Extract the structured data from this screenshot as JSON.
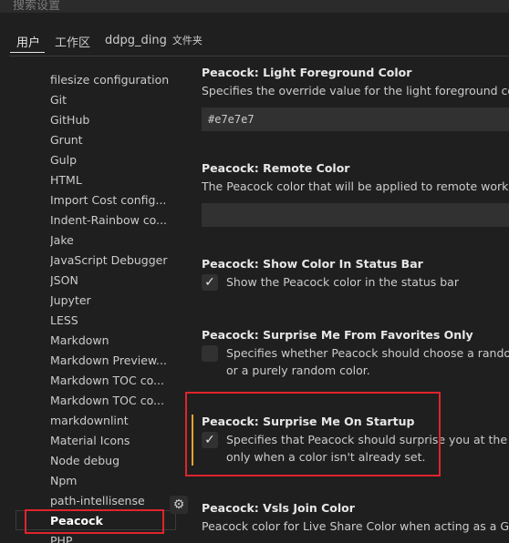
{
  "search": {
    "placeholder": "搜索设置"
  },
  "tabs": {
    "user": "用户",
    "workspace": "工作区",
    "folder": "ddpg_ding",
    "folder_suffix": "文件夹"
  },
  "toc": {
    "items": [
      "filesize configuration",
      "Git",
      "GitHub",
      "Grunt",
      "Gulp",
      "HTML",
      "Import Cost config...",
      "Indent-Rainbow co...",
      "Jake",
      "JavaScript Debugger",
      "JSON",
      "Jupyter",
      "LESS",
      "Markdown",
      "Markdown Preview...",
      "Markdown TOC co...",
      "Markdown TOC co...",
      "markdownlint",
      "Material Icons",
      "Node debug",
      "Npm",
      "path-intellisense",
      "Peacock",
      "PHP"
    ],
    "selected_index": 22
  },
  "settings": {
    "light_fg": {
      "title": "Peacock: Light Foreground Color",
      "desc": "Specifies the override value for the light foreground color",
      "value": "#e7e7e7"
    },
    "remote": {
      "title": "Peacock: Remote Color",
      "desc": "The Peacock color that will be applied to remote workspace",
      "value": ""
    },
    "status_bar": {
      "title": "Peacock: Show Color In Status Bar",
      "desc": "Show the Peacock color in the status bar",
      "checked": true
    },
    "favorites_only": {
      "title": "Peacock: Surprise Me From Favorites Only",
      "desc1": "Specifies whether Peacock should choose a random co",
      "desc2": "or a purely random color.",
      "checked": false
    },
    "on_startup": {
      "title": "Peacock: Surprise Me On Startup",
      "desc1": "Specifies that Peacock should surprise you at the start",
      "desc2": "only when a color isn't already set.",
      "checked": true
    },
    "vsls": {
      "title": "Peacock: Vsls Join Color",
      "desc": "Peacock color for Live Share Color when acting as a Guest"
    }
  },
  "icons": {
    "checkmark": "check-icon",
    "gear": "gear-icon"
  },
  "colors": {
    "highlight": "#e0242c",
    "focus": "#e2a330",
    "background": "#1f1f1f"
  }
}
